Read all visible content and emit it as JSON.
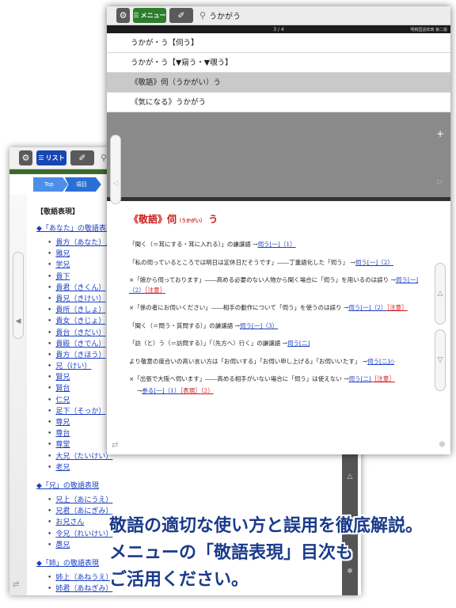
{
  "back": {
    "toolbar": {
      "gear": "⚙",
      "list_label": "リスト",
      "pen": "✐",
      "search": "⚲"
    },
    "breadcrumb": {
      "top": "Top",
      "item": "項目"
    },
    "section_title": "【敬語表現】",
    "group1_title": "「あなた」の敬語表現",
    "group1_items": [
      "貴方（あなた）／貴",
      "雅兄",
      "学兄",
      "貴下",
      "貴君（きくん）",
      "貴兄（きけい）",
      "貴所（きしょ）",
      "貴女（きじょ）",
      "貴台（きだい）",
      "貴殿（きでん）",
      "貴方（きほう）",
      "兄（けい）",
      "賢兄",
      "賢台",
      "仁兄",
      "足下（そっか）",
      "尊兄",
      "尊台",
      "尊堂",
      "大兄（たいけい）",
      "老兄"
    ],
    "group2_title": "「兄」の敬語表現",
    "group2_items": [
      "兄上（あにうえ）",
      "兄君（あにぎみ）",
      "お兄さん",
      "令兄（れいけい）",
      "愚兄"
    ],
    "group3_title": "「姉」の敬語表現",
    "group3_items": [
      "姉上（あねうえ）",
      "姉君（あねぎみ）"
    ]
  },
  "front": {
    "toolbar": {
      "gear": "⚙",
      "menu_label": "メニュー",
      "pen": "✐",
      "search_icon": "⚲",
      "query": "うかがう"
    },
    "page": "3 / 4",
    "dictionary": "明鏡国語辞典 第二版",
    "results": [
      "うかが・う【伺う】",
      "うかが・う【▼窺う・▼覗う】",
      "《敬語》伺（うかがい）う",
      "《気になる》うかがう"
    ],
    "selected_index": 2,
    "entry": {
      "title_main": "《敬語》伺",
      "title_ruby": "（うかがい）",
      "title_tail": "う",
      "lines": [
        {
          "text": "「聞く（＝耳にする・耳に入れる）」の謙譲語 →",
          "link": "伺う[一]（1）",
          "extra": ""
        },
        {
          "text": "「私の伺っているところでは明日は定休日だそうです」――丁重語化した「伺う」 →",
          "link": "伺う[一]（2）",
          "extra": ""
        },
        {
          "text": "×「娘から伺っております」――高める必要のない人物から聞く場合に「伺う」を用いるのは誤り →",
          "link": "伺う[一]（2）",
          "extra": "［注意］"
        },
        {
          "text": "×「係の者にお伺いください」――相手の動作について「伺う」を使うのは誤り →",
          "link": "伺う[一]（2）",
          "extra": "［注意］"
        },
        {
          "text": "「聞く（＝問う・質問する）」の謙譲語 →",
          "link": "伺う[一]（3）",
          "extra": ""
        },
        {
          "text": "「訪（と）う（＝訪問する）」「（先方へ）行く」の謙譲語 →",
          "link": "伺う[二]",
          "extra": ""
        },
        {
          "text": "より敬意の度合いの高い言い方は「お伺いする」「お伺い申し上げる」「お伺いいたす」 →",
          "link": "伺う[二]◇",
          "extra": ""
        },
        {
          "text": "×「出張で大阪へ伺います」――高める相手がいない場合に「伺う」は使えない →",
          "link": "伺う[二]",
          "extra": "［注意］"
        }
      ],
      "ref_prefix": "→",
      "ref_link1": "参る[一]（1）",
      "ref_link2": "［表現］",
      "ref_link3": "（2）"
    }
  },
  "caption": {
    "line1": "敬語の適切な使い方と誤用を徹底解説。",
    "line2": "メニューの「敬語表現」目次も",
    "line3": "ご活用ください。"
  }
}
